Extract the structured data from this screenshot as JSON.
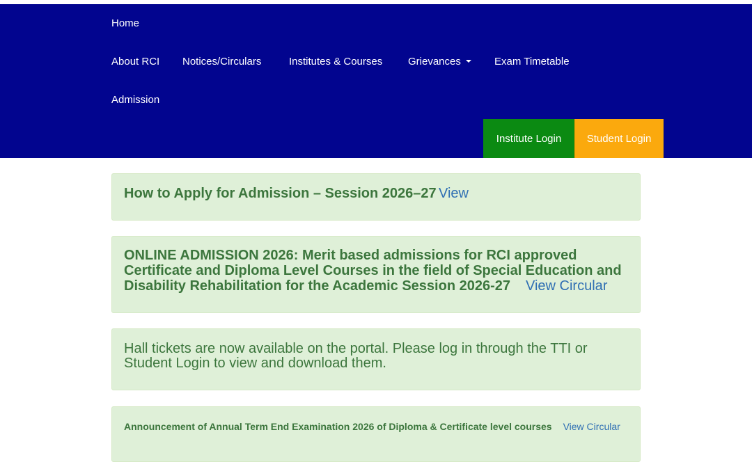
{
  "nav": {
    "home": "Home",
    "about": "About RCI",
    "notices": "Notices/Circulars",
    "institutes": "Institutes & Courses",
    "grievances": "Grievances",
    "exam_timetable": "Exam Timetable",
    "admission": "Admission",
    "institute_login": "Institute Login",
    "student_login": "Student Login"
  },
  "colors": {
    "navbar_bg": "#02058f",
    "institute_login_bg": "#0b8a12",
    "student_login_bg": "#fba90d",
    "notice_bg": "#dff0d8",
    "notice_text": "#3c763d",
    "link": "#2f6fb3"
  },
  "notices": [
    {
      "text": "How to Apply for Admission – Session 2026–27",
      "link": "View"
    },
    {
      "text": "ONLINE ADMISSION 2026: Merit based admissions for RCI approved Certificate and Diploma Level Courses in the field of Special Education and Disability Rehabilitation for the Academic Session 2026-27",
      "link": "View Circular"
    },
    {
      "text": "Hall tickets are now available on the portal. Please log in through the TTI or Student Login to view and download them."
    },
    {
      "text": "Announcement of Annual Term End Examination 2026 of Diploma & Certificate level courses",
      "link": "View Circular"
    }
  ],
  "icons": {
    "grievances_dropdown": "caret-down-icon"
  }
}
